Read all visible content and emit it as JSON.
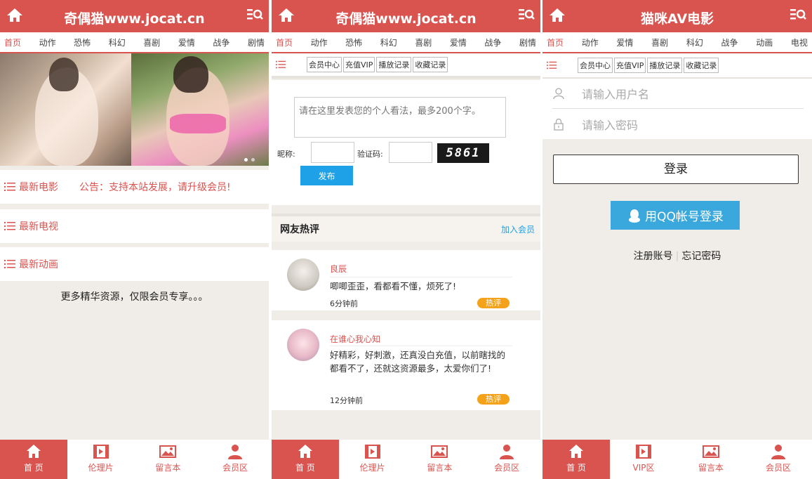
{
  "panels": [
    {
      "title": "奇偶猫www.jocat.cn",
      "nav": [
        "首页",
        "动作",
        "恐怖",
        "科幻",
        "喜剧",
        "爱情",
        "战争",
        "剧情"
      ],
      "sections": [
        {
          "label": "最新电影",
          "notice": "公告：支持本站发展，请升级会员!"
        },
        {
          "label": "最新电视"
        },
        {
          "label": "最新动画"
        }
      ],
      "more_text": "更多精华资源，仅限会员专享。。。",
      "tabs": [
        "首 页",
        "伦理片",
        "留言本",
        "会员区"
      ]
    },
    {
      "title": "奇偶猫www.jocat.cn",
      "nav": [
        "首页",
        "动作",
        "恐怖",
        "科幻",
        "喜剧",
        "爱情",
        "战争",
        "剧情"
      ],
      "subnav": [
        "会员中心",
        "充值VIP",
        "播放记录",
        "收藏记录"
      ],
      "textarea_placeholder": "请在这里发表您的个人看法，最多200个字。",
      "nickname_label": "昵称:",
      "captcha_label": "验证码:",
      "captcha_text": "5861",
      "publish_button": "发布",
      "hot_title": "网友热评",
      "join_link": "加入会员",
      "comments": [
        {
          "name": "良辰",
          "text": "唧唧歪歪，看都看不懂，烦死了!",
          "time": "6分钟前",
          "badge": "热评"
        },
        {
          "name": "在谁心我心知",
          "text": "好精彩，好刺激，还真没白充值，以前瞎找的都看不了，还就这资源最多，太爱你们了!",
          "time": "12分钟前",
          "badge": "热评"
        }
      ],
      "tabs": [
        "首 页",
        "伦理片",
        "留言本",
        "会员区"
      ]
    },
    {
      "title": "猫咪AV电影",
      "nav": [
        "首页",
        "动作",
        "爱情",
        "喜剧",
        "科幻",
        "战争",
        "动画",
        "电视"
      ],
      "subnav": [
        "会员中心",
        "充值VIP",
        "播放记录",
        "收藏记录"
      ],
      "username_placeholder": "请输入用户名",
      "password_placeholder": "请输入密码",
      "login_button": "登录",
      "qq_login": "用QQ帐号登录",
      "register": "注册账号",
      "sep": "|",
      "forgot": "忘记密码",
      "tabs": [
        "首 页",
        "VIP区",
        "留言本",
        "会员区"
      ]
    }
  ],
  "colors": {
    "brand": "#d9534f",
    "blue": "#1ea1e6",
    "badge": "#f5a21b"
  }
}
